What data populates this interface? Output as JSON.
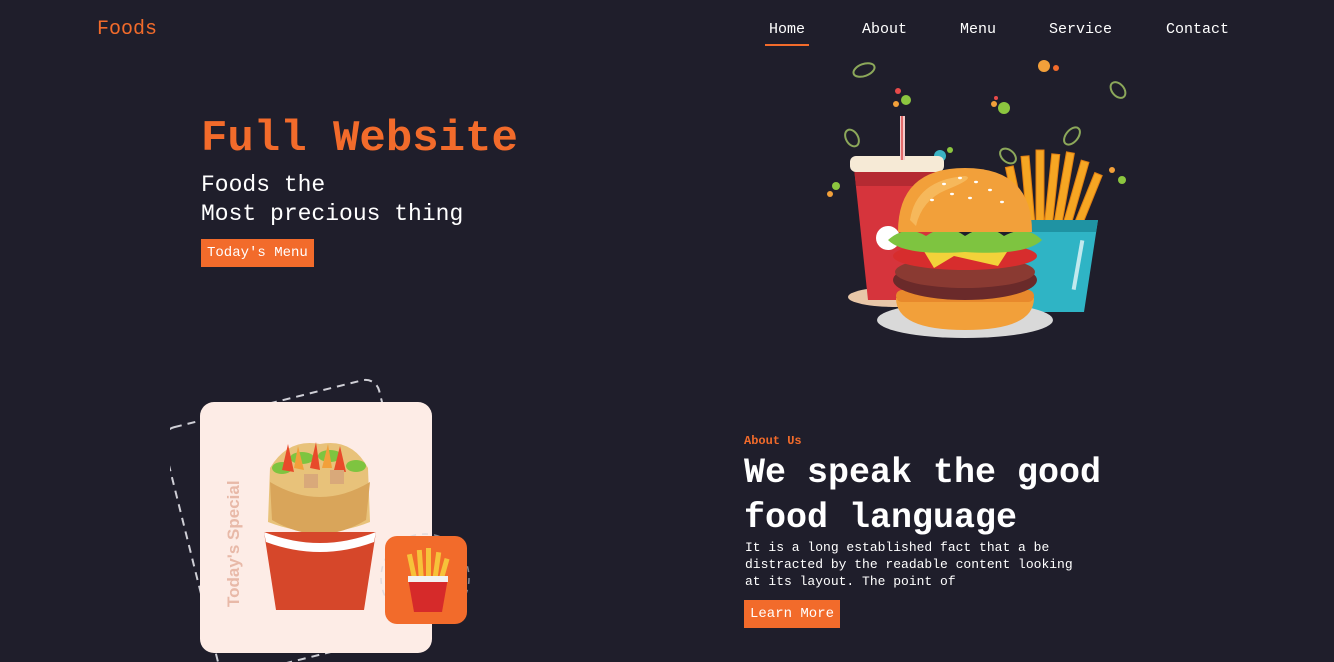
{
  "header": {
    "logo": "Foods",
    "nav": [
      {
        "label": "Home",
        "active": true
      },
      {
        "label": "About",
        "active": false
      },
      {
        "label": "Menu",
        "active": false
      },
      {
        "label": "Service",
        "active": false
      },
      {
        "label": "Contact",
        "active": false
      }
    ]
  },
  "hero": {
    "title": "Full Website",
    "subtitle_line1": "Foods the",
    "subtitle_line2": "Most precious thing",
    "button": "Today's Menu"
  },
  "special": {
    "label": "Today's Special"
  },
  "about": {
    "kicker": "About Us",
    "title": "We speak the good food language",
    "text": "It is a long established fact that a be distracted by the readable content looking at its layout. The point of",
    "button": "Learn More"
  },
  "colors": {
    "accent": "#f26b2b",
    "background": "#1f1e2b",
    "card": "#fdece6"
  }
}
